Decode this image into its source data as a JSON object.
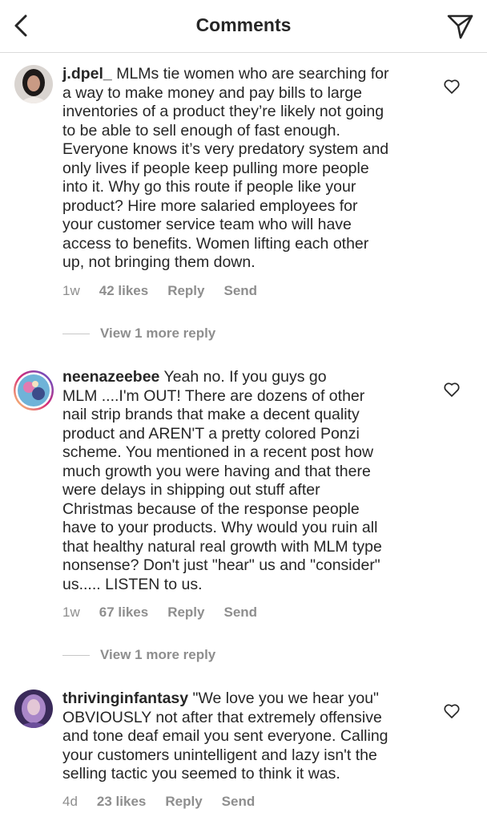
{
  "header": {
    "title": "Comments",
    "back_icon": "chevron-left-icon",
    "send_icon": "paper-plane-icon"
  },
  "comments": [
    {
      "username": "j.dpel_",
      "text": " MLMs tie women who are searching for\na way to make money and pay bills to large\ninventories of a product they’re likely not going\nto be able to sell enough of fast enough.\nEveryone knows it’s very predatory system and\nonly lives if people keep pulling more people\ninto it. Why go this route if people like your\nproduct? Hire more salaried employees for\nyour customer service team who will have\naccess to benefits. Women lifting each other\nup, not bringing them down.",
      "time": "1w",
      "likes": "42 likes",
      "reply": "Reply",
      "send": "Send",
      "view_more": "View 1 more reply"
    },
    {
      "username": "neenazeebee",
      "text": " Yeah no. If you guys go\nMLM ....I'm OUT! There are dozens of other\nnail strip brands that make a decent quality\nproduct and AREN'T a pretty colored Ponzi\nscheme. You mentioned in a recent post how\nmuch growth you were having and that there\nwere delays in shipping out stuff after\nChristmas because of the response people\nhave to your products. Why would you ruin all\nthat healthy natural real growth with MLM type\nnonsense? Don't just \"hear\" us and \"consider\"\nus..... LISTEN to us.",
      "time": "1w",
      "likes": "67 likes",
      "reply": "Reply",
      "send": "Send",
      "view_more": "View 1 more reply"
    },
    {
      "username": "thrivinginfantasy",
      "text": " \"We love you we hear you\"\nOBVIOUSLY not after that extremely offensive\nand tone deaf email you sent everyone. Calling\nyour customers unintelligent and lazy isn't the\nselling tactic you seemed to think it was.",
      "time": "4d",
      "likes": "23 likes",
      "reply": "Reply",
      "send": "Send"
    }
  ],
  "colors": {
    "text": "#262626",
    "muted": "#8e8e8e",
    "divider": "#dbdbdb",
    "story_ring_start": "#feda75",
    "story_ring_mid": "#d62976",
    "story_ring_end": "#4f5bd5"
  }
}
